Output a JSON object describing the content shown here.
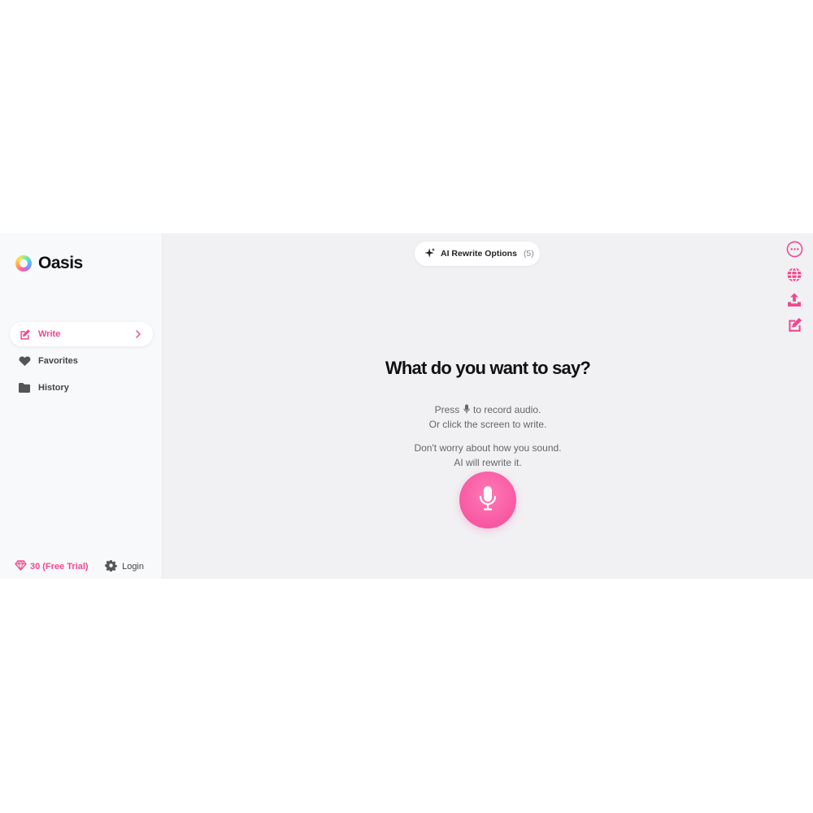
{
  "app": {
    "name": "Oasis"
  },
  "sidebar": {
    "items": [
      {
        "label": "Write",
        "icon": "pencil-square-icon",
        "active": true
      },
      {
        "label": "Favorites",
        "icon": "heart-icon",
        "active": false
      },
      {
        "label": "History",
        "icon": "folder-icon",
        "active": false
      }
    ],
    "footer": {
      "credits_label": "30 (Free Trial)",
      "login_label": "Login"
    }
  },
  "main": {
    "rewrite_options": {
      "label": "AI Rewrite Options",
      "count": "(5)"
    },
    "headline": "What do you want to say?",
    "helper_line_1a": "Press",
    "helper_line_1b": "to record audio.",
    "helper_line_2": "Or click the screen to write.",
    "helper_line_3": "Don't worry about how you sound.",
    "helper_line_4": "AI will rewrite it."
  },
  "right_tools": [
    {
      "icon": "more-options-icon"
    },
    {
      "icon": "globe-icon"
    },
    {
      "icon": "upload-icon"
    },
    {
      "icon": "edit-icon"
    }
  ],
  "colors": {
    "accent": "#f0478f",
    "sidebar_bg": "#f8f9fb",
    "main_bg": "#f1f1f3",
    "text_dark": "#111111"
  }
}
